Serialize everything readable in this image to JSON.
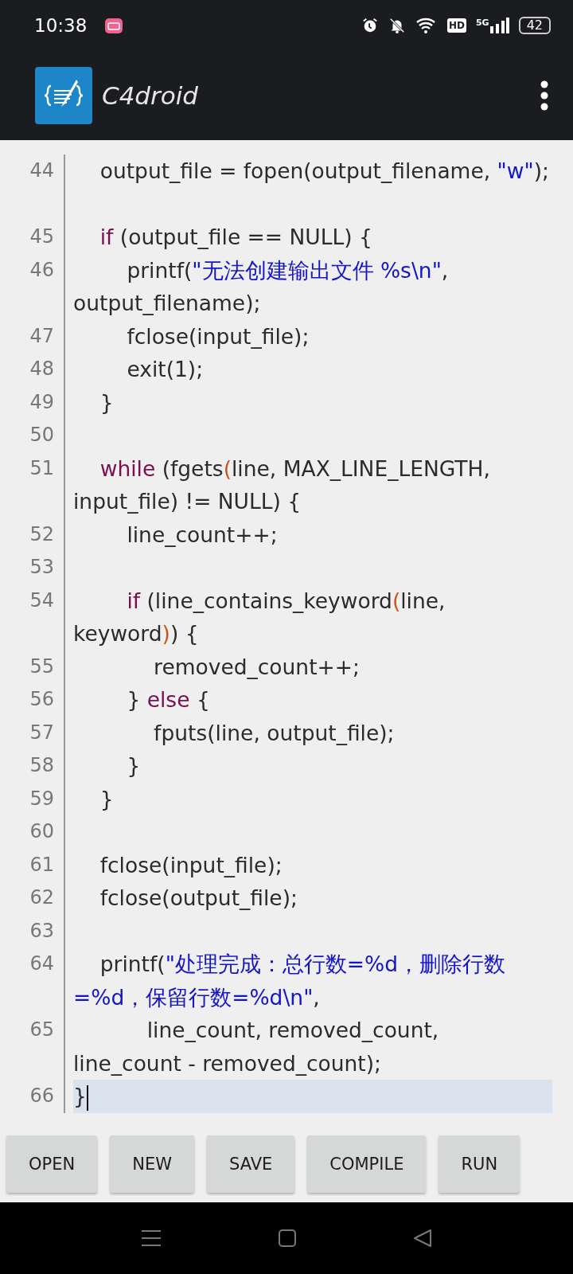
{
  "status_bar": {
    "time": "10:38",
    "network_badge": "HD",
    "network_type": "5G",
    "battery": "42"
  },
  "app_bar": {
    "title": "C4droid"
  },
  "editor": {
    "lines": [
      {
        "number": "44",
        "current": false,
        "blank_wrap": true,
        "segments": [
          {
            "kind": "plain",
            "text": "    output_file = fopen(output_filename, "
          },
          {
            "kind": "string",
            "text": "\"w\""
          },
          {
            "kind": "plain",
            "text": ");"
          }
        ]
      },
      {
        "number": "45",
        "current": false,
        "blank_wrap": false,
        "segments": [
          {
            "kind": "keyword",
            "text": "    if"
          },
          {
            "kind": "plain",
            "text": " (output_file == NULL) {"
          }
        ]
      },
      {
        "number": "46",
        "current": false,
        "blank_wrap": false,
        "segments": [
          {
            "kind": "plain",
            "text": "        printf("
          },
          {
            "kind": "string",
            "text": "\"无法创建输出文件 %s\\n\""
          },
          {
            "kind": "plain",
            "text": ", output_filename);"
          }
        ]
      },
      {
        "number": "47",
        "current": false,
        "blank_wrap": false,
        "segments": [
          {
            "kind": "plain",
            "text": "        fclose(input_file);"
          }
        ]
      },
      {
        "number": "48",
        "current": false,
        "blank_wrap": false,
        "segments": [
          {
            "kind": "plain",
            "text": "        exit(1);"
          }
        ]
      },
      {
        "number": "49",
        "current": false,
        "blank_wrap": false,
        "segments": [
          {
            "kind": "plain",
            "text": "    }"
          }
        ]
      },
      {
        "number": "50",
        "current": false,
        "blank_wrap": false
      },
      {
        "number": "51",
        "current": false,
        "blank_wrap": false,
        "segments": [
          {
            "kind": "keyword",
            "text": "    while"
          },
          {
            "kind": "plain",
            "text": " (fgets"
          },
          {
            "kind": "bracket",
            "text": "("
          },
          {
            "kind": "plain",
            "text": "line, MAX_LINE_LENGTH, input_file) != NULL) {"
          }
        ]
      },
      {
        "number": "52",
        "current": false,
        "blank_wrap": false,
        "segments": [
          {
            "kind": "plain",
            "text": "        line_count++;"
          }
        ]
      },
      {
        "number": "53",
        "current": false,
        "blank_wrap": false
      },
      {
        "number": "54",
        "current": false,
        "blank_wrap": false,
        "segments": [
          {
            "kind": "keyword",
            "text": "        if"
          },
          {
            "kind": "plain",
            "text": " (line_contains_keyword"
          },
          {
            "kind": "bracket",
            "text": "("
          },
          {
            "kind": "plain",
            "text": "line, keyword"
          },
          {
            "kind": "bracket",
            "text": ")"
          },
          {
            "kind": "plain",
            "text": ") {"
          }
        ]
      },
      {
        "number": "55",
        "current": false,
        "blank_wrap": false,
        "segments": [
          {
            "kind": "plain",
            "text": "            removed_count++;"
          }
        ]
      },
      {
        "number": "56",
        "current": false,
        "blank_wrap": false,
        "segments": [
          {
            "kind": "plain",
            "text": "        } "
          },
          {
            "kind": "keyword",
            "text": "else"
          },
          {
            "kind": "plain",
            "text": " {"
          }
        ]
      },
      {
        "number": "57",
        "current": false,
        "blank_wrap": false,
        "segments": [
          {
            "kind": "plain",
            "text": "            fputs(line, output_file);"
          }
        ]
      },
      {
        "number": "58",
        "current": false,
        "blank_wrap": false,
        "segments": [
          {
            "kind": "plain",
            "text": "        }"
          }
        ]
      },
      {
        "number": "59",
        "current": false,
        "blank_wrap": false,
        "segments": [
          {
            "kind": "plain",
            "text": "    }"
          }
        ]
      },
      {
        "number": "60",
        "current": false,
        "blank_wrap": false
      },
      {
        "number": "61",
        "current": false,
        "blank_wrap": false,
        "segments": [
          {
            "kind": "plain",
            "text": "    fclose(input_file);"
          }
        ]
      },
      {
        "number": "62",
        "current": false,
        "blank_wrap": false,
        "segments": [
          {
            "kind": "plain",
            "text": "    fclose(output_file);"
          }
        ]
      },
      {
        "number": "63",
        "current": false,
        "blank_wrap": false
      },
      {
        "number": "64",
        "current": false,
        "blank_wrap": false,
        "segments": [
          {
            "kind": "plain",
            "text": "    printf("
          },
          {
            "kind": "string",
            "text": "\"处理完成：总行数=%d，删除行数=%d，保留行数=%d\\n\""
          },
          {
            "kind": "plain",
            "text": ","
          }
        ]
      },
      {
        "number": "65",
        "current": false,
        "blank_wrap": false,
        "segments": [
          {
            "kind": "plain",
            "text": "           line_count, removed_count, line_count - removed_count);"
          }
        ]
      },
      {
        "number": "66",
        "current": true,
        "blank_wrap": false,
        "segments": [
          {
            "kind": "plain",
            "text": "}"
          }
        ]
      }
    ]
  },
  "toolbar": {
    "buttons": [
      "OPEN",
      "NEW",
      "SAVE",
      "COMPILE",
      "RUN"
    ]
  }
}
